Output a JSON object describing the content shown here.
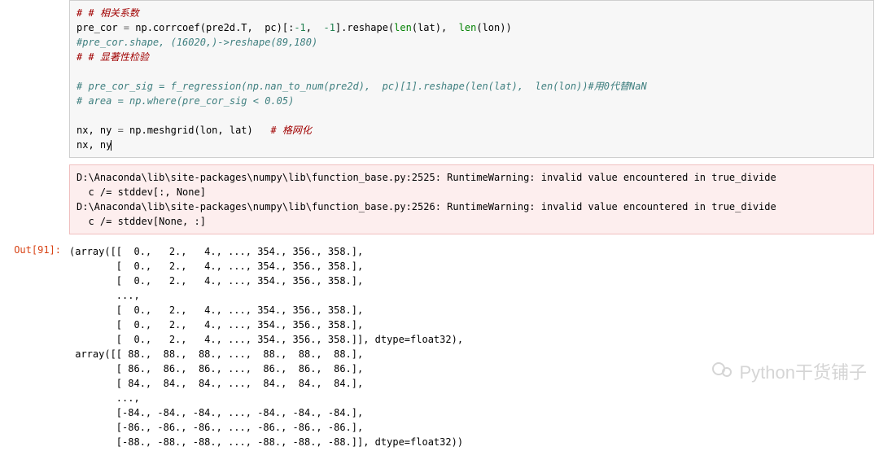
{
  "code": {
    "l0": "# # 相关系数",
    "l1a": "pre_cor ",
    "l1b": "=",
    "l1c": " np.corrcoef(pre2d.T,  pc)[:",
    "l1d": "-1",
    "l1e": ",  ",
    "l1f": "-1",
    "l1g": "].reshape(",
    "l1h": "len",
    "l1i": "(lat),  ",
    "l1j": "len",
    "l1k": "(lon))",
    "l2": "#pre_cor.shape, (16020,)->reshape(89,180)",
    "l3": "# # 显著性检验",
    "l4": "",
    "l5": "# pre_cor_sig = f_regression(np.nan_to_num(pre2d),  pc)[1].reshape(len(lat),  len(lon))#用0代替NaN",
    "l6": "# area = np.where(pre_cor_sig < 0.05)",
    "l7": "",
    "l8a": "nx, ny ",
    "l8b": "=",
    "l8c": " np.meshgrid(lon, lat)   ",
    "l8d": "# 格网化",
    "l9": "nx, ny"
  },
  "warning": {
    "w1": "D:\\Anaconda\\lib\\site-packages\\numpy\\lib\\function_base.py:2525: RuntimeWarning: invalid value encountered in true_divide",
    "w2": "  c /= stddev[:, None]",
    "w3": "D:\\Anaconda\\lib\\site-packages\\numpy\\lib\\function_base.py:2526: RuntimeWarning: invalid value encountered in true_divide",
    "w4": "  c /= stddev[None, :]"
  },
  "out_prompt": "Out[91]:",
  "output": {
    "o1": "(array([[  0.,   2.,   4., ..., 354., 356., 358.],",
    "o2": "        [  0.,   2.,   4., ..., 354., 356., 358.],",
    "o3": "        [  0.,   2.,   4., ..., 354., 356., 358.],",
    "o4": "        ...,",
    "o5": "        [  0.,   2.,   4., ..., 354., 356., 358.],",
    "o6": "        [  0.,   2.,   4., ..., 354., 356., 358.],",
    "o7": "        [  0.,   2.,   4., ..., 354., 356., 358.]], dtype=float32),",
    "o8": " array([[ 88.,  88.,  88., ...,  88.,  88.,  88.],",
    "o9": "        [ 86.,  86.,  86., ...,  86.,  86.,  86.],",
    "o10": "        [ 84.,  84.,  84., ...,  84.,  84.,  84.],",
    "o11": "        ...,",
    "o12": "        [-84., -84., -84., ..., -84., -84., -84.],",
    "o13": "        [-86., -86., -86., ..., -86., -86., -86.],",
    "o14": "        [-88., -88., -88., ..., -88., -88., -88.]], dtype=float32))"
  },
  "watermark_text": "Python干货铺子"
}
